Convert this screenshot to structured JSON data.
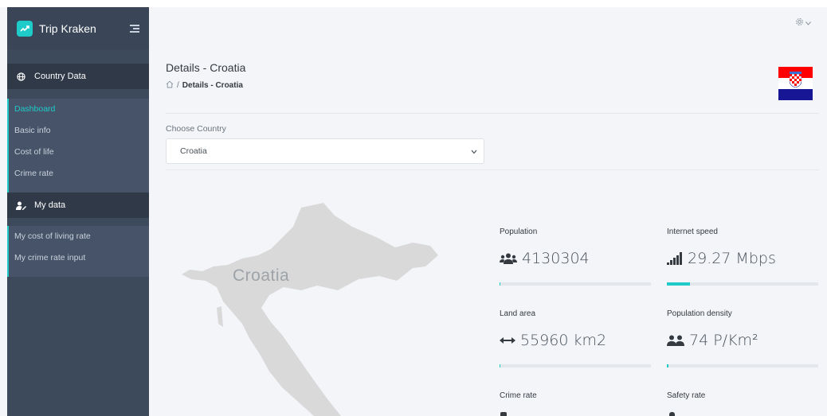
{
  "app": {
    "name": "Trip Kraken"
  },
  "sidebar": {
    "sections": [
      {
        "label": "Country Data",
        "icon": "globe-icon",
        "items": [
          {
            "label": "Dashboard",
            "active": true
          },
          {
            "label": "Basic info"
          },
          {
            "label": "Cost of life"
          },
          {
            "label": "Crime rate"
          }
        ]
      },
      {
        "label": "My data",
        "icon": "user-edit-icon",
        "items": [
          {
            "label": "My cost of living rate"
          },
          {
            "label": "My crime rate input"
          }
        ]
      }
    ]
  },
  "header": {
    "title": "Details - Croatia",
    "breadcrumb": {
      "separator": "/",
      "current": "Details - Croatia"
    }
  },
  "form": {
    "label": "Choose Country",
    "selected": "Croatia"
  },
  "map": {
    "label": "Croatia"
  },
  "stats": {
    "population": {
      "label": "Population",
      "value": "4130304",
      "icon": "users-icon",
      "progress": 0.005
    },
    "internet": {
      "label": "Internet speed",
      "value": "29.27 Mbps",
      "icon": "signal-icon",
      "progress": 0.15
    },
    "land": {
      "label": "Land area",
      "value": "55960 km2",
      "icon": "arrows-horizontal-icon",
      "progress": 0.005
    },
    "density": {
      "label": "Population density",
      "value": "74 P/Km²",
      "icon": "user-friends-icon",
      "progress": 0.01
    },
    "crime": {
      "label": "Crime rate"
    },
    "safety": {
      "label": "Safety rate"
    }
  },
  "colors": {
    "accent": "#1fcbc9",
    "sidebar": "#3d4a5c",
    "sidebar_dark": "#2f3948",
    "flag_red": "#ff0000",
    "flag_white": "#ffffff",
    "flag_blue": "#171796"
  }
}
